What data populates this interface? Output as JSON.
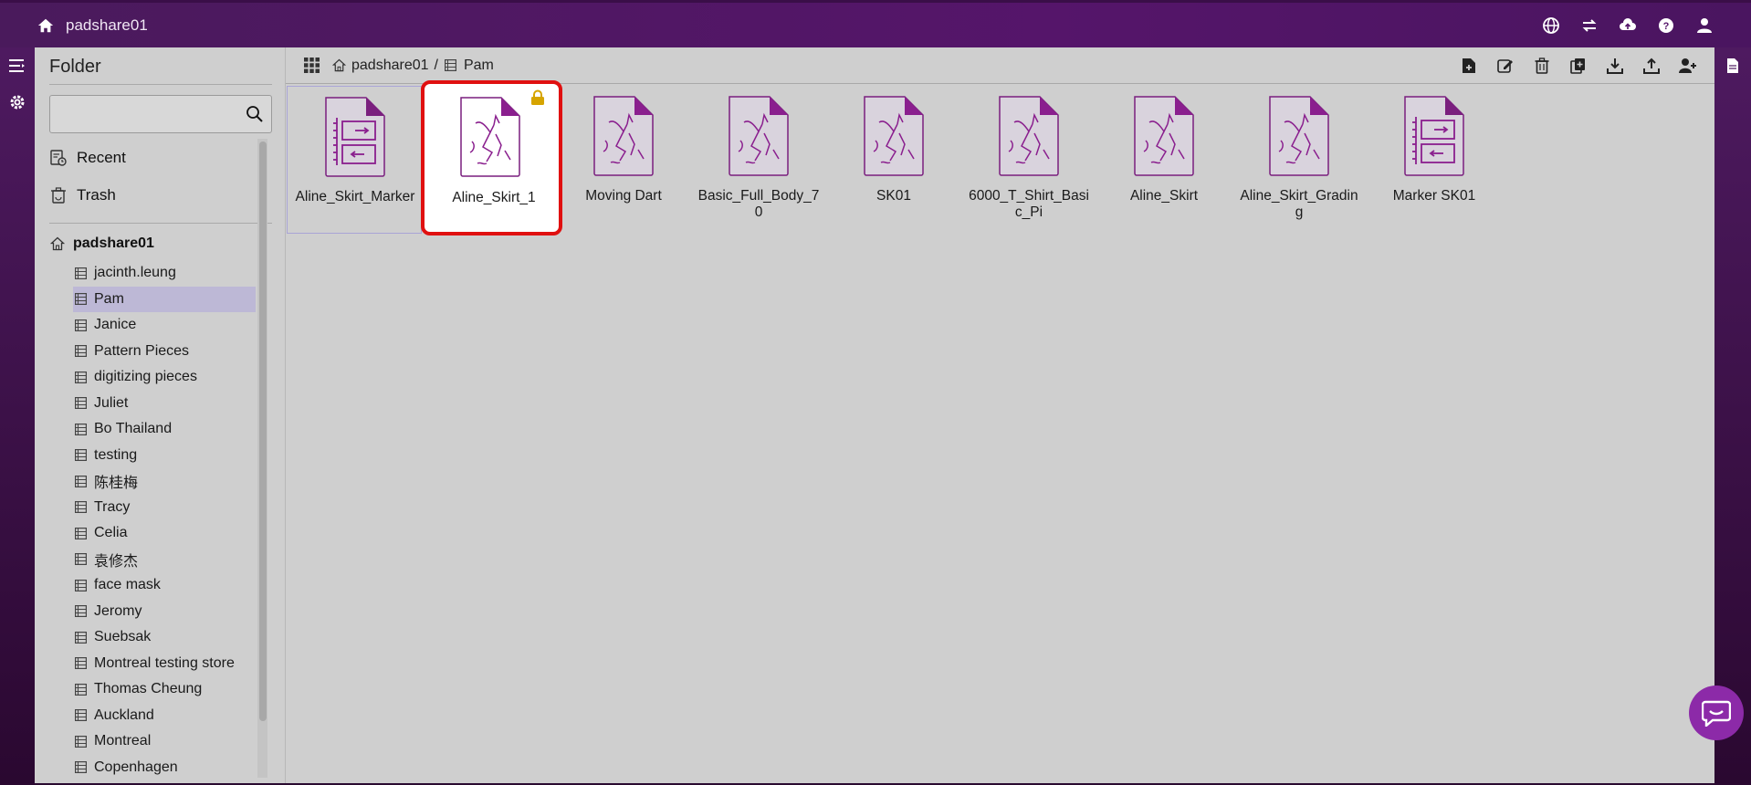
{
  "topbar": {
    "title": "padshare01",
    "icons": [
      "home-icon",
      "globe-icon",
      "transfer-icon",
      "cloud-upload-icon",
      "help-icon",
      "user-icon"
    ]
  },
  "sidebar": {
    "heading": "Folder",
    "search_placeholder": "",
    "nav": [
      {
        "label": "Recent",
        "icon": "recent-icon"
      },
      {
        "label": "Trash",
        "icon": "trash-icon"
      }
    ],
    "root": "padshare01",
    "folders": [
      "jacinth.leung",
      "Pam",
      "Janice",
      "Pattern Pieces",
      "digitizing pieces",
      "Juliet",
      "Bo Thailand",
      "testing",
      "陈桂梅",
      "Tracy",
      "Celia",
      "袁修杰",
      "face mask",
      "Jeromy",
      "Suebsak",
      "Montreal testing store",
      "Thomas Cheung",
      "Auckland",
      "Montreal",
      "Copenhagen"
    ],
    "active_folder": "Pam"
  },
  "breadcrumb": {
    "root": "padshare01",
    "separator": "/",
    "current": "Pam"
  },
  "files": [
    {
      "name": "Aline_Skirt_Marker",
      "kind": "marker",
      "state": "selected"
    },
    {
      "name": "Aline_Skirt_1",
      "kind": "pattern",
      "state": "highlight",
      "locked": true
    },
    {
      "name": "Moving Dart",
      "kind": "pattern"
    },
    {
      "name": "Basic_Full_Body_70",
      "kind": "pattern"
    },
    {
      "name": "SK01",
      "kind": "pattern"
    },
    {
      "name": "6000_T_Shirt_Basic_Pi",
      "kind": "pattern"
    },
    {
      "name": "Aline_Skirt",
      "kind": "pattern"
    },
    {
      "name": "Aline_Skirt_Grading",
      "kind": "pattern"
    },
    {
      "name": "Marker SK01",
      "kind": "marker"
    }
  ],
  "colors": {
    "accent": "#8a1f8e",
    "topbar": "#4f1863",
    "highlight": "#e01010",
    "lock": "#d6a400"
  }
}
